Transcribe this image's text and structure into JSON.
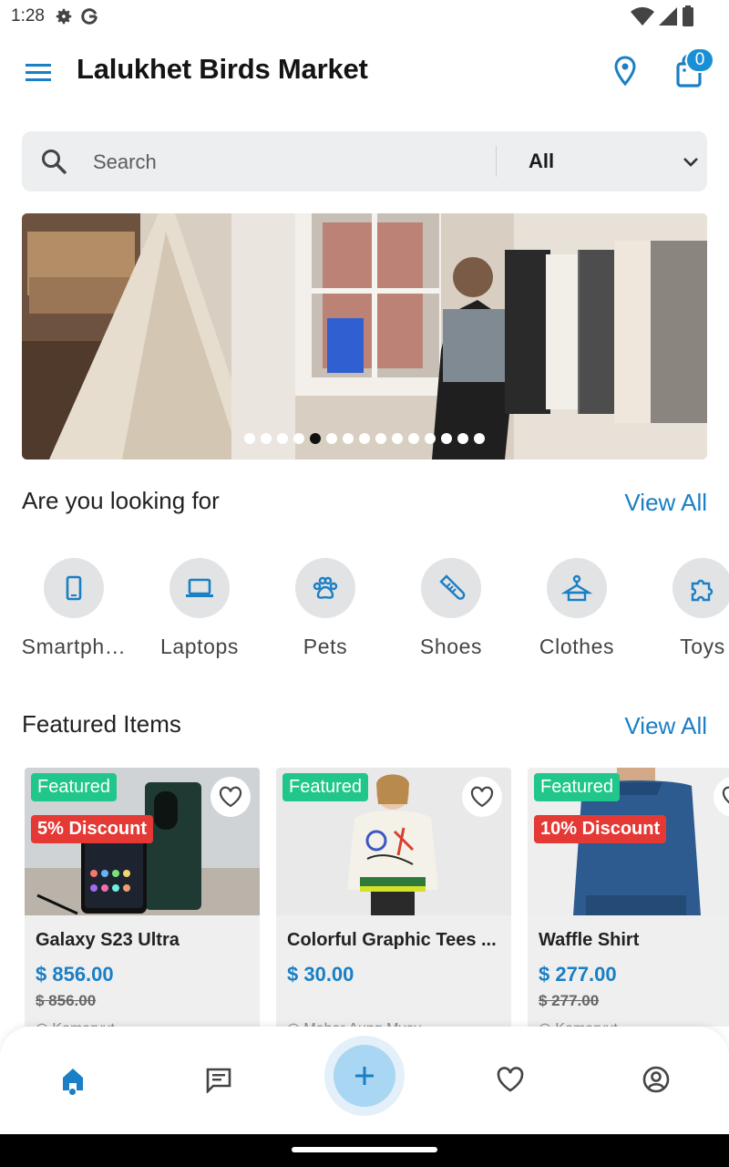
{
  "status_bar": {
    "time": "1:28"
  },
  "app_bar": {
    "title": "Lalukhet Birds Market",
    "cart_count": "0"
  },
  "search": {
    "placeholder": "Search",
    "category": "All"
  },
  "banner": {
    "slide_count": 15,
    "active_index": 4
  },
  "looking_for": {
    "title": "Are you looking for",
    "view_all": "View All",
    "categories": [
      {
        "label": "Smartph…",
        "icon": "smartphone-icon"
      },
      {
        "label": "Laptops",
        "icon": "laptop-icon"
      },
      {
        "label": "Pets",
        "icon": "paw-icon"
      },
      {
        "label": "Shoes",
        "icon": "shoe-icon"
      },
      {
        "label": "Clothes",
        "icon": "hanger-icon"
      },
      {
        "label": "Toys",
        "icon": "puzzle-icon"
      }
    ]
  },
  "featured": {
    "title": "Featured Items",
    "view_all": "View All",
    "items": [
      {
        "badge": "Featured",
        "discount": "5% Discount",
        "name": "Galaxy S23 Ultra",
        "price": "$ 856.00",
        "old_price": "$ 856.00",
        "location": "◎ Kamaryut"
      },
      {
        "badge": "Featured",
        "discount": "",
        "name": "Colorful Graphic Tees ...",
        "price": "$ 30.00",
        "old_price": "",
        "location": "◎ Mahar Aung Myay"
      },
      {
        "badge": "Featured",
        "discount": "10% Discount",
        "name": "Waffle Shirt",
        "price": "$ 277.00",
        "old_price": "$ 277.00",
        "location": "◎ Kamaryut"
      }
    ]
  },
  "bottom_nav": {
    "items": [
      "home-icon",
      "chat-icon",
      "add-icon",
      "heart-icon",
      "account-icon"
    ],
    "active": "home-icon"
  },
  "colors": {
    "accent": "#1a7fc4",
    "featured_badge": "#21c78a",
    "discount_badge": "#e53935"
  }
}
